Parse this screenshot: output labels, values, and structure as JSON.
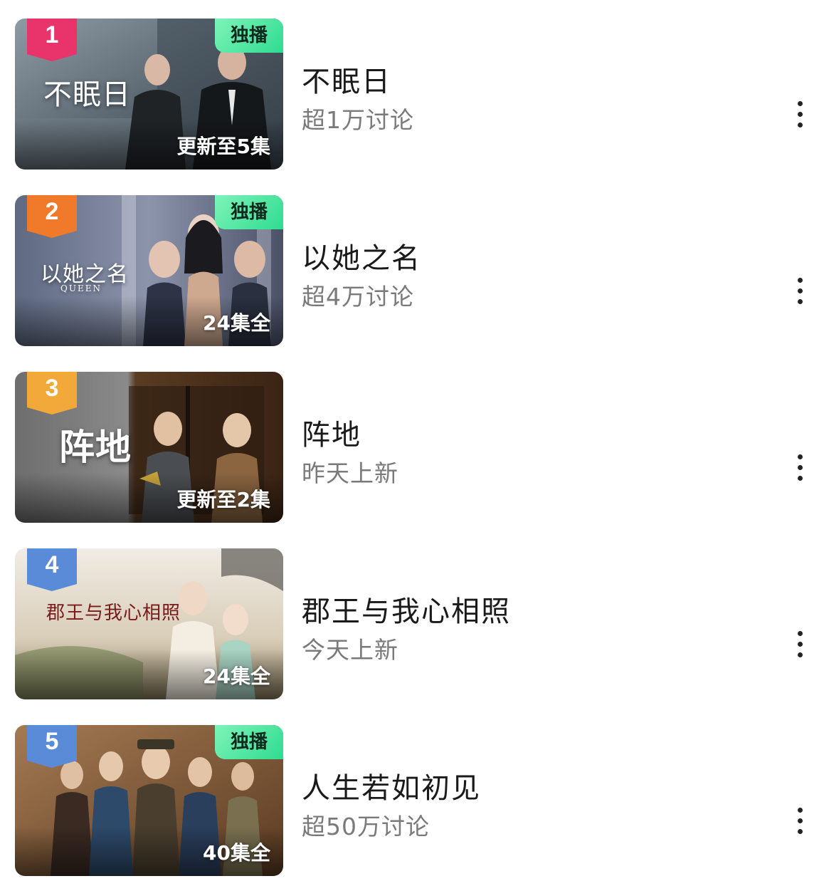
{
  "badge_exclusive": "独播",
  "colors": {
    "rank_1": "#e8346b",
    "rank_2": "#f07a2a",
    "rank_3": "#f2a93a",
    "rank_4": "#5a8bd8",
    "rank_5": "#5a8bd8",
    "exclusive_badge": "#3fe39b"
  },
  "items": [
    {
      "rank": "1",
      "poster_title": "不眠日",
      "title": "不眠日",
      "subtitle": "超1万讨论",
      "episodes": "更新至5集",
      "exclusive": true
    },
    {
      "rank": "2",
      "poster_title": "以她之名",
      "poster_subtitle": "QUEEN",
      "title": "以她之名",
      "subtitle": "超4万讨论",
      "episodes": "24集全",
      "exclusive": true
    },
    {
      "rank": "3",
      "poster_title": "阵地",
      "title": "阵地",
      "subtitle": "昨天上新",
      "episodes": "更新至2集",
      "exclusive": false
    },
    {
      "rank": "4",
      "poster_title": "郡王与我心相照",
      "title": "郡王与我心相照",
      "subtitle": "今天上新",
      "episodes": "24集全",
      "exclusive": false
    },
    {
      "rank": "5",
      "title": "人生若如初见",
      "subtitle": "超50万讨论",
      "episodes": "40集全",
      "exclusive": true
    }
  ]
}
